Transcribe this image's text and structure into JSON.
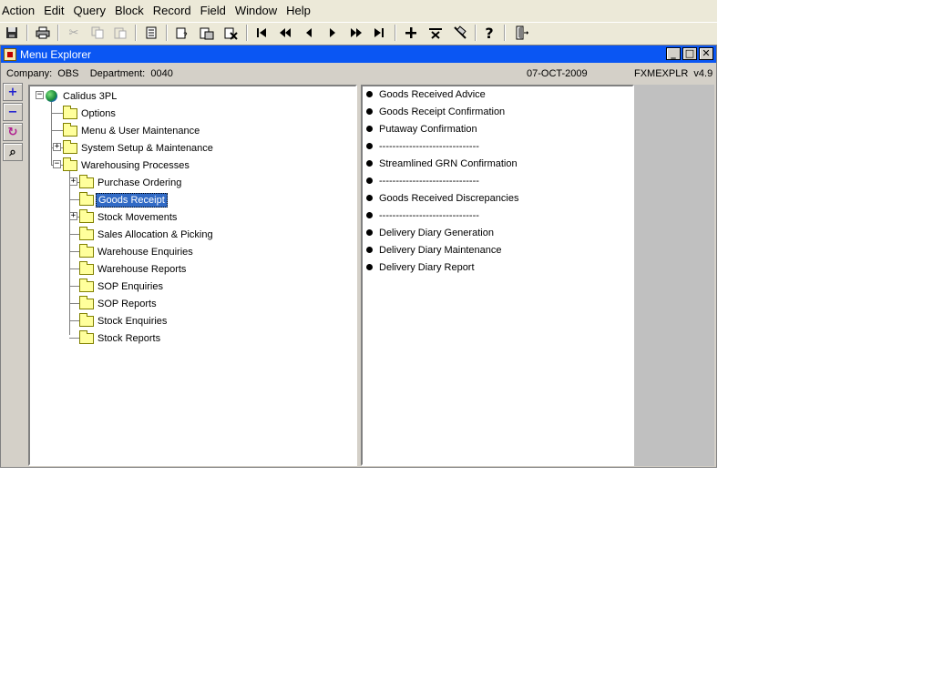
{
  "menubar": {
    "items": [
      {
        "label": "Action"
      },
      {
        "label": "Edit"
      },
      {
        "label": "Query"
      },
      {
        "label": "Block"
      },
      {
        "label": "Record"
      },
      {
        "label": "Field"
      },
      {
        "label": "Window"
      },
      {
        "label": "Help"
      }
    ]
  },
  "toolbar": {
    "help_glyph": "?",
    "icons": [
      "save-icon",
      "print-icon",
      "cut-icon",
      "copy-icon",
      "paste-icon",
      "clear-form-icon",
      "enter-query-icon",
      "execute-query-icon",
      "cancel-query-icon",
      "first-record-icon",
      "previous-block-icon",
      "previous-record-icon",
      "next-record-icon",
      "next-block-icon",
      "last-record-icon",
      "insert-record-icon",
      "delete-record-icon",
      "clear-record-icon",
      "help-icon",
      "exit-icon"
    ]
  },
  "window": {
    "title": "Menu Explorer",
    "controls": {
      "minimize": "_",
      "maximize": "□",
      "close": "✕"
    }
  },
  "infobar": {
    "company_text": "Company:  OBS    Department:  0040",
    "date": "07-OCT-2009",
    "form": "FXMEXPLR  v4.9"
  },
  "side_tools": {
    "expand": "+",
    "collapse": "−",
    "refresh": "↻",
    "search": "⌕"
  },
  "tree": {
    "root": "Calidus 3PL",
    "level1": [
      "Options",
      "Menu & User Maintenance",
      "System Setup & Maintenance",
      "Warehousing Processes"
    ],
    "level2": [
      "Purchase Ordering",
      "Goods Receipt",
      "Stock Movements",
      "Sales Allocation & Picking",
      "Warehouse Enquiries",
      "Warehouse Reports",
      "SOP Enquiries",
      "SOP Reports",
      "Stock Enquiries",
      "Stock Reports"
    ],
    "selected": "Goods Receipt"
  },
  "list": {
    "items": [
      "Goods Received Advice",
      "Goods Receipt Confirmation",
      "Putaway Confirmation",
      "------------------------------",
      "Streamlined GRN Confirmation",
      "------------------------------",
      "Goods Received Discrepancies",
      "------------------------------",
      "Delivery Diary Generation",
      "Delivery Diary Maintenance",
      "Delivery Diary Report"
    ]
  }
}
